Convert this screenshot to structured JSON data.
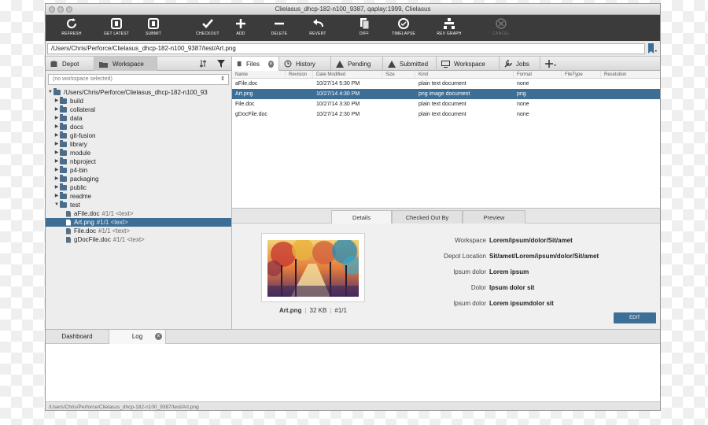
{
  "window": {
    "title": "Clielasus_dhcp-182-n100_9387, qaplay:1999, Clielasus"
  },
  "toolbar": {
    "refresh": "REFRESH",
    "get_latest": "GET LATEST",
    "submit": "SUBMIT",
    "checkout": "CHECKOUT",
    "add": "ADD",
    "delete": "DELETE",
    "revert": "REVERT",
    "diff": "DIFF",
    "timelapse": "TIMELAPSE",
    "rev_graph": "REV GRAPH",
    "cancel": "CANCEL"
  },
  "path": {
    "value": "/Users/Chris/Perforce/Clielasus_dhcp-182-n100_9387/test/Art.png"
  },
  "left_tabs": {
    "depot": "Depot",
    "workspace": "Workspace"
  },
  "workspace_select": {
    "value": "(no workspace selected)"
  },
  "tree": {
    "root": "/Users/Chris/Perforce/Clielasus_dhcp-182-n100_93",
    "folders": [
      "build",
      "collateral",
      "data",
      "docs",
      "git-fusion",
      "library",
      "module",
      "nbproject",
      "p4-bin",
      "packaging",
      "public",
      "readme",
      "test"
    ],
    "files": [
      {
        "name": "aFile.doc",
        "meta": "#1/1 <text>"
      },
      {
        "name": "Art.png",
        "meta": "#1/1 <text>"
      },
      {
        "name": "File.doc",
        "meta": "#1/1 <text>"
      },
      {
        "name": "gDocFile.doc",
        "meta": "#1/1 <text>"
      }
    ]
  },
  "right_tabs": {
    "files": "Files",
    "history": "History",
    "pending": "Pending",
    "submitted": "Submitted",
    "workspace": "Workspace",
    "jobs": "Jobs"
  },
  "file_table": {
    "headers": [
      "Name",
      "Revision",
      "Date Modified",
      "Size",
      "Kind",
      "Format",
      "FileType",
      "Resolution"
    ],
    "rows": [
      {
        "name": "aFile.doc",
        "revision": "",
        "date": "10/27/14 5:30 PM",
        "size": "",
        "kind": "plain text document",
        "format": "none"
      },
      {
        "name": "Art.png",
        "revision": "",
        "date": "10/27/14 4:30 PM",
        "size": "",
        "kind": "png image document",
        "format": "png"
      },
      {
        "name": "File.doc",
        "revision": "",
        "date": "10/27/14 3:30 PM",
        "size": "",
        "kind": "plain text document",
        "format": "none"
      },
      {
        "name": "gDocFile.doc",
        "revision": "",
        "date": "10/27/14 2:30 PM",
        "size": "",
        "kind": "plain text document",
        "format": "none"
      }
    ]
  },
  "detail_tabs": {
    "details": "Details",
    "checked_out_by": "Checked Out By",
    "preview": "Preview"
  },
  "details": {
    "file_name": "Art.png",
    "file_size": "32 KB",
    "revision": "#1/1",
    "fields": [
      {
        "key": "Workspace",
        "value": "Lorem/ipsum/dolor/Sit/amet"
      },
      {
        "key": "Depot Location",
        "value": "Sit/amet/Lorem/ipsum/dolor/Sit/amet"
      },
      {
        "key": "Ipsum dolor",
        "value": "Lorem ipsum"
      },
      {
        "key": "Dolor",
        "value": "Ipsum dolor sit"
      },
      {
        "key": "Ipsum dolor",
        "value": "Lorem ipsumdolor sit"
      }
    ],
    "edit_label": "EDIT"
  },
  "bottom_tabs": {
    "dashboard": "Dashboard",
    "log": "Log"
  },
  "status": {
    "path": "/Users/Chris/Perforce/Clielasus_dhcp-182-n100_9387/test/Art.png"
  },
  "colors": {
    "toolbar_bg": "#3b3b3b",
    "selection": "#3d6e96",
    "accent_button": "#3d6e96"
  },
  "icons": [
    "refresh-icon",
    "get-latest-icon",
    "submit-icon",
    "checkout-icon",
    "add-icon",
    "delete-icon",
    "revert-icon",
    "diff-icon",
    "timelapse-icon",
    "rev-graph-icon",
    "cancel-icon",
    "bookmark-icon",
    "depot-icon",
    "workspace-icon",
    "filter-icon",
    "sort-icon",
    "files-icon",
    "close-icon",
    "history-icon",
    "pending-icon",
    "submitted-icon",
    "monitor-icon",
    "jobs-icon",
    "plus-icon"
  ]
}
